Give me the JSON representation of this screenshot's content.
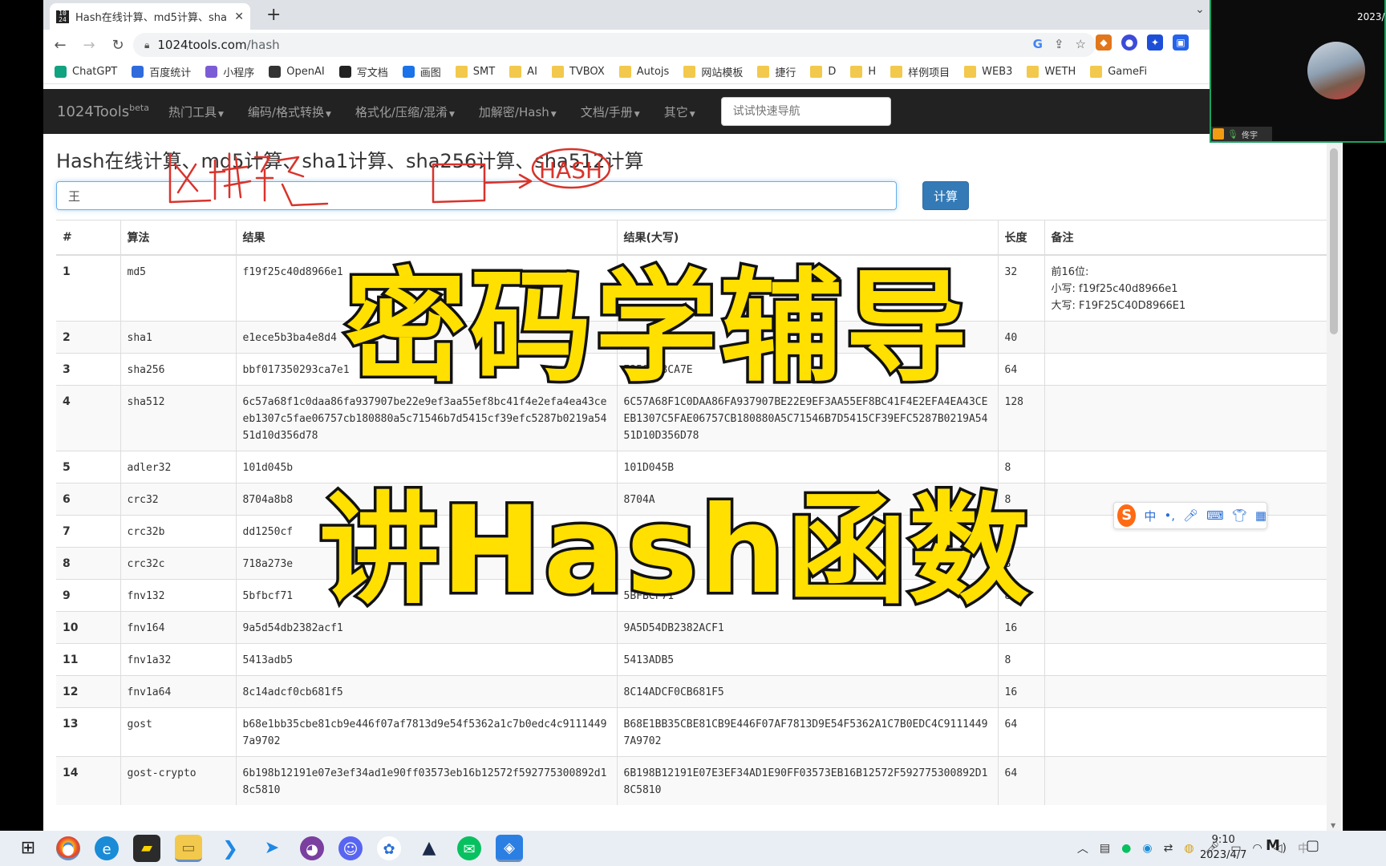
{
  "browser": {
    "tab_title": "Hash在线计算、md5计算、sha",
    "tab_favicon": "10\n24",
    "new_tab_icon": "+",
    "url_domain": "1024tools.com",
    "url_path": "/hash",
    "bookmarks": [
      {
        "label": "ChatGPT",
        "icon": "chatgpt-icon",
        "color": "#10a37f"
      },
      {
        "label": "百度统计",
        "icon": "baidu-icon",
        "color": "#2f6bdc"
      },
      {
        "label": "小程序",
        "icon": "link-icon",
        "color": "#7c5cd6"
      },
      {
        "label": "OpenAI",
        "icon": "openai-icon",
        "color": "#333333"
      },
      {
        "label": "写文档",
        "icon": "doc-icon",
        "color": "#222222"
      },
      {
        "label": "画图",
        "icon": "draw-icon",
        "color": "#1a73e8"
      },
      {
        "label": "SMT",
        "icon": "folder-icon"
      },
      {
        "label": "AI",
        "icon": "folder-icon"
      },
      {
        "label": "TVBOX",
        "icon": "folder-icon"
      },
      {
        "label": "Autojs",
        "icon": "folder-icon"
      },
      {
        "label": "网站模板",
        "icon": "folder-icon"
      },
      {
        "label": "捷行",
        "icon": "folder-icon"
      },
      {
        "label": "D",
        "icon": "folder-icon"
      },
      {
        "label": "H",
        "icon": "folder-icon"
      },
      {
        "label": "样例项目",
        "icon": "folder-icon"
      },
      {
        "label": "WEB3",
        "icon": "folder-icon"
      },
      {
        "label": "WETH",
        "icon": "folder-icon"
      },
      {
        "label": "GameFi",
        "icon": "folder-icon"
      }
    ]
  },
  "site": {
    "brand": "1024Tools",
    "brand_sup": "beta",
    "nav": [
      "热门工具",
      "编码/格式转换",
      "格式化/压缩/混淆",
      "加解密/Hash",
      "文档/手册",
      "其它"
    ],
    "search_placeholder": "试试快速导航",
    "page_title": "Hash在线计算、md5计算、sha1计算、sha256计算、sha512计算",
    "input_value": "王",
    "calc_button": "计算",
    "table_headers": [
      "#",
      "算法",
      "结果",
      "结果(大写)",
      "长度",
      "备注"
    ]
  },
  "rows": [
    {
      "n": "1",
      "algo": "md5",
      "result": "f19f25c40d8966e1",
      "upper": "",
      "len": "32",
      "note": [
        "前16位:",
        "小写: f19f25c40d8966e1",
        "大写: F19F25C40D8966E1"
      ]
    },
    {
      "n": "2",
      "algo": "sha1",
      "result": "e1ece5b3ba4e8d4",
      "upper": "",
      "len": "40",
      "note": []
    },
    {
      "n": "3",
      "algo": "sha256",
      "result": "bbf017350293ca7e1",
      "upper": "7350293CA7E",
      "len": "64",
      "note": []
    },
    {
      "n": "4",
      "algo": "sha512",
      "result": "6c57a68f1c0daa86fa937907be22e9ef3aa55ef8bc41f4e2efa4ea43ceeb1307c5fae06757cb180880a5c71546b7d5415cf39efc5287b0219a5451d10d356d78",
      "upper": "6C57A68F1C0DAA86FA937907BE22E9EF3AA55EF8BC41F4E2EFA4EA43CEEB1307C5FAE06757CB180880A5C71546B7D5415CF39EFC5287B0219A5451D10D356D78",
      "len": "128",
      "note": []
    },
    {
      "n": "5",
      "algo": "adler32",
      "result": "101d045b",
      "upper": "101D045B",
      "len": "8",
      "note": []
    },
    {
      "n": "6",
      "algo": "crc32",
      "result": "8704a8b8",
      "upper": "8704A",
      "len": "8",
      "note": []
    },
    {
      "n": "7",
      "algo": "crc32b",
      "result": "dd1250cf",
      "upper": "",
      "len": "8",
      "note": []
    },
    {
      "n": "8",
      "algo": "crc32c",
      "result": "718a273e",
      "upper": "",
      "len": "8",
      "note": []
    },
    {
      "n": "9",
      "algo": "fnv132",
      "result": "5bfbcf71",
      "upper": "5BFBCF71",
      "len": "8",
      "note": []
    },
    {
      "n": "10",
      "algo": "fnv164",
      "result": "9a5d54db2382acf1",
      "upper": "9A5D54DB2382ACF1",
      "len": "16",
      "note": []
    },
    {
      "n": "11",
      "algo": "fnv1a32",
      "result": "5413adb5",
      "upper": "5413ADB5",
      "len": "8",
      "note": []
    },
    {
      "n": "12",
      "algo": "fnv1a64",
      "result": "8c14adcf0cb681f5",
      "upper": "8C14ADCF0CB681F5",
      "len": "16",
      "note": []
    },
    {
      "n": "13",
      "algo": "gost",
      "result": "b68e1bb35cbe81cb9e446f07af7813d9e54f5362a1c7b0edc4c91114497a9702",
      "upper": "B68E1BB35CBE81CB9E446F07AF7813D9E54F5362A1C7B0EDC4C91114497A9702",
      "len": "64",
      "note": []
    },
    {
      "n": "14",
      "algo": "gost-crypto",
      "result": "6b198b12191e07e3ef34ad1e90ff03573eb16b12572f592775300892d18c5810",
      "upper": "6B198B12191E07E3EF34AD1E90FF03573EB16B12572F592775300892D18C5810",
      "len": "64",
      "note": []
    }
  ],
  "overlay": {
    "caption_line1": "密码学辅导",
    "caption_line2": "讲Hash函数",
    "scribble_text": "HASH"
  },
  "ime_toolbar": {
    "logo": "S",
    "lang": "中",
    "punct": "•,"
  },
  "webcam": {
    "name_label": "佟宇"
  },
  "taskbar": {
    "time": "9:10",
    "date": "2023/4/7",
    "date_cut": "2023/",
    "ime_lang": "中",
    "mi_logo": "M"
  }
}
